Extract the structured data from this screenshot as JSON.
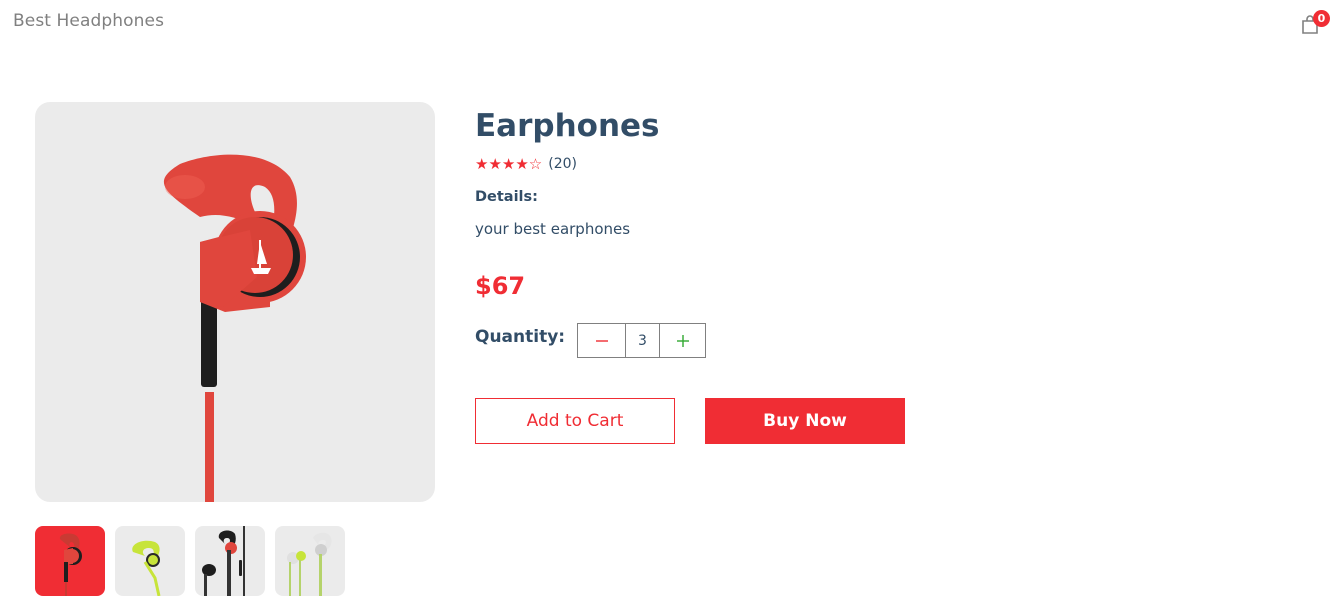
{
  "navbar": {
    "logo": "Best Headphones",
    "cart_icon": "shopping-bag-icon",
    "cart_count": "0"
  },
  "product": {
    "name": "Earphones",
    "rating": {
      "stars_filled": 4,
      "stars_total": 5,
      "stars_text": "★★★★☆",
      "count": "(20)"
    },
    "details_heading": "Details:",
    "details": "your best earphones",
    "price": "$67"
  },
  "quantity": {
    "label": "Quantity:",
    "value": "3",
    "minus_icon": "minus-icon",
    "plus_icon": "plus-icon"
  },
  "actions": {
    "add_to_cart": "Add to Cart",
    "buy_now": "Buy Now"
  },
  "gallery": {
    "thumbnails": [
      "red-earphone",
      "lime-earphone",
      "black-red-earphones-pair",
      "white-green-earphones-pair"
    ],
    "selected_index": 0
  },
  "colors": {
    "accent": "#f02d34",
    "text": "#324d67",
    "muted": "#808080",
    "image_bg": "#ebebeb"
  }
}
